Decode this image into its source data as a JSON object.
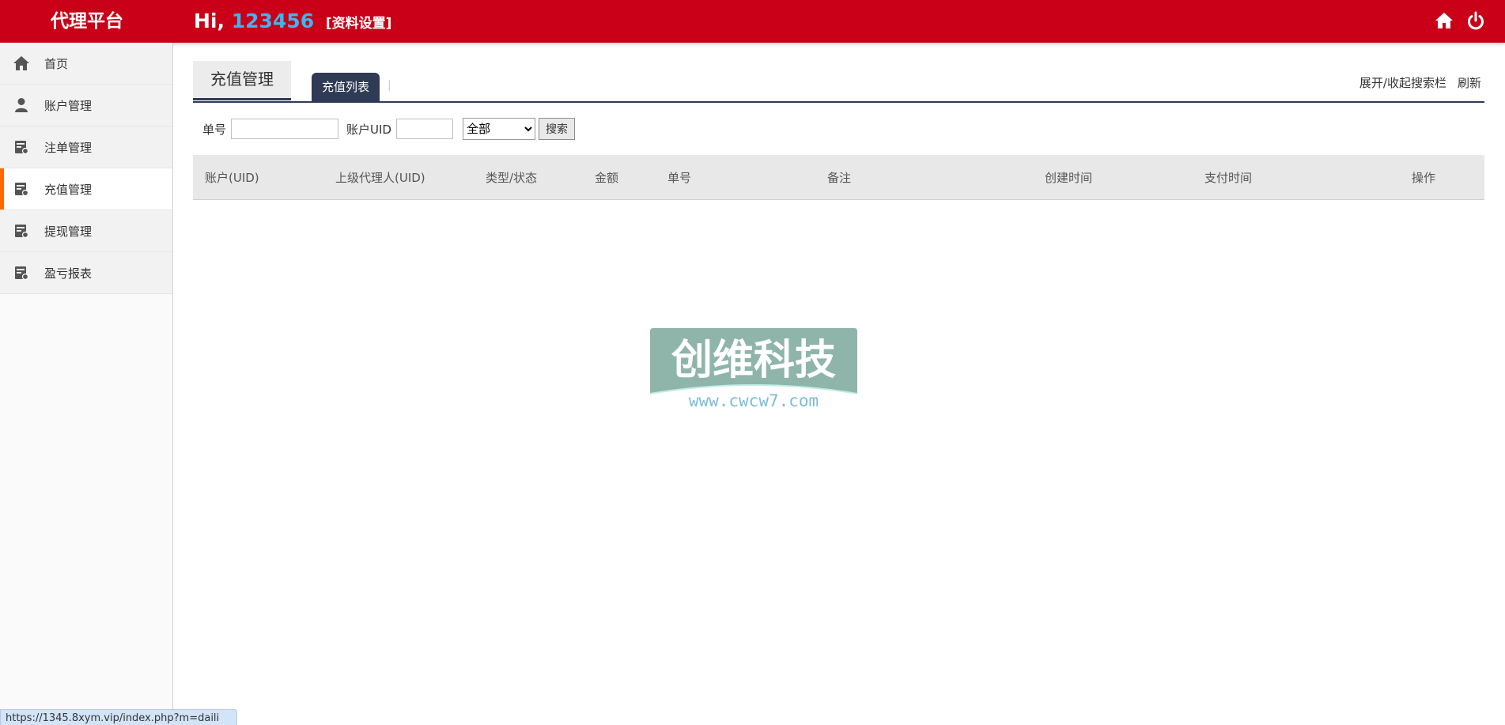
{
  "header": {
    "brand": "代理平台",
    "greeting_prefix": "Hi,",
    "user_id": "123456",
    "profile_link": "[资料设置]",
    "icons": [
      "home-icon",
      "power-icon"
    ]
  },
  "sidebar": {
    "items": [
      {
        "label": "首页",
        "icon": "home-icon"
      },
      {
        "label": "账户管理",
        "icon": "user-icon"
      },
      {
        "label": "注单管理",
        "icon": "document-icon"
      },
      {
        "label": "充值管理",
        "icon": "document-icon",
        "active": true
      },
      {
        "label": "提现管理",
        "icon": "document-icon"
      },
      {
        "label": "盈亏报表",
        "icon": "document-icon"
      }
    ]
  },
  "main": {
    "page_title": "充值管理",
    "active_tab": "充值列表",
    "tab_separator": "|",
    "toggle_search_label": "展开/收起搜索栏",
    "refresh_label": "刷新",
    "search": {
      "order_label": "单号",
      "order_value": "",
      "uid_label": "账户UID",
      "uid_value": "",
      "status_selected": "全部",
      "search_button": "搜索"
    },
    "table": {
      "columns": [
        "账户(UID)",
        "上级代理人(UID)",
        "类型/状态",
        "金额",
        "单号",
        "备注",
        "创建时间",
        "支付时间",
        "操作"
      ],
      "rows": []
    }
  },
  "watermark": {
    "title": "创维科技",
    "url": "www.cwcw7.com"
  },
  "statusbar": {
    "url": "https://1345.8xym.vip/index.php?m=daili"
  },
  "colors": {
    "header_bg": "#c90017",
    "user_id": "#3fb4f0",
    "active_indicator": "#ff6a00",
    "tab_active_bg": "#2f3b55"
  }
}
